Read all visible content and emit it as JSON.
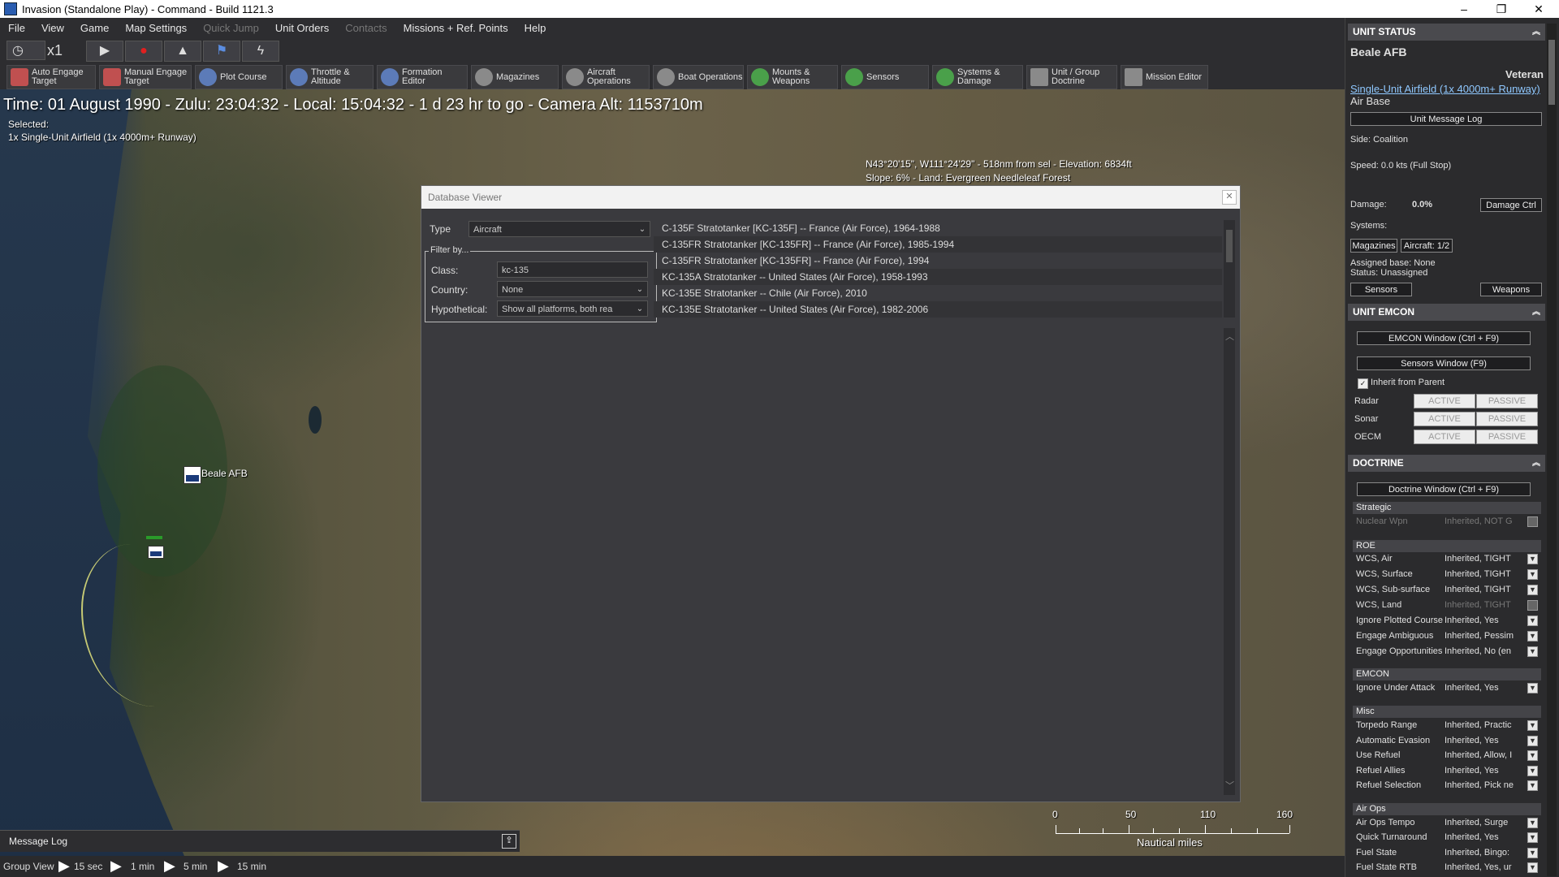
{
  "window": {
    "title": "Invasion (Standalone Play) - Command - Build 1121.3",
    "minimize": "–",
    "restore": "❐",
    "close": "✕"
  },
  "menu": [
    "File",
    "View",
    "Game",
    "Map Settings",
    "Quick Jump",
    "Unit Orders",
    "Contacts",
    "Missions + Ref. Points",
    "Help"
  ],
  "controls": {
    "speed": "x1"
  },
  "toolbar": [
    {
      "label": "Auto Engage Target"
    },
    {
      "label": "Manual Engage Target"
    },
    {
      "label": "Plot Course"
    },
    {
      "label": "Throttle & Altitude"
    },
    {
      "label": "Formation Editor"
    },
    {
      "label": "Magazines"
    },
    {
      "label": "Aircraft Operations"
    },
    {
      "label": "Boat Operations"
    },
    {
      "label": "Mounts & Weapons"
    },
    {
      "label": "Sensors"
    },
    {
      "label": "Systems & Damage"
    },
    {
      "label": "Unit / Group Doctrine"
    },
    {
      "label": "Mission Editor"
    }
  ],
  "map": {
    "time_line": "Time: 01 August 1990 - Zulu: 23:04:32 - Local: 15:04:32 - 1 d 23 hr to go -  Camera Alt: 1153710m",
    "selected_label": "Selected:",
    "selected_value": "1x Single-Unit Airfield (1x 4000m+ Runway)",
    "coords": "N43°20'15\", W111°24'29\" - 518nm from sel - Elevation: 6834ft",
    "terrain": "Slope: 6%  - Land: Evergreen Needleleaf Forest",
    "unit_label": "Beale AFB",
    "scale_ticks": [
      "0",
      "50",
      "110",
      "160"
    ],
    "scale_unit": "Nautical miles"
  },
  "dialog": {
    "title": "Database Viewer",
    "type_label": "Type",
    "type_value": "Aircraft",
    "filter_label": "Filter by...",
    "class_label": "Class:",
    "class_value": "kc-135",
    "country_label": "Country:",
    "country_value": "None",
    "hypo_label": "Hypothetical:",
    "hypo_value": "Show all platforms, both rea",
    "results": [
      "C-135F Stratotanker [KC-135F] -- France (Air Force), 1964-1988",
      "C-135FR Stratotanker [KC-135FR] -- France (Air Force), 1985-1994",
      "C-135FR Stratotanker [KC-135FR] -- France (Air Force), 1994",
      "KC-135A Stratotanker -- United States (Air Force), 1958-1993",
      "KC-135E Stratotanker -- Chile (Air Force), 2010",
      "KC-135E Stratotanker -- United States (Air Force), 1982-2006"
    ]
  },
  "panel": {
    "unit_status_head": "UNIT STATUS",
    "unit_name": "Beale AFB",
    "proficiency": "Veteran",
    "unit_class": "Single-Unit Airfield (1x 4000m+ Runway)",
    "unit_type": "Air Base",
    "msg_log_btn": "Unit Message Log",
    "side": "Side: Coalition",
    "speed": "Speed: 0.0 kts (Full Stop)",
    "damage_label": "Damage:",
    "damage_value": "0.0%",
    "damage_btn": "Damage Ctrl",
    "systems_label": "Systems:",
    "magazines_btn": "Magazines",
    "aircraft_btn": "Aircraft: 1/2",
    "assigned_base": "Assigned base: None",
    "status": "Status: Unassigned",
    "sensors_btn": "Sensors",
    "weapons_btn": "Weapons",
    "emcon_head": "UNIT EMCON",
    "emcon_window_btn": "EMCON Window (Ctrl + F9)",
    "sensors_window_btn": "Sensors Window (F9)",
    "inherit_label": "Inherit from Parent",
    "emcon_rows": [
      {
        "name": "Radar",
        "active": "ACTIVE",
        "passive": "PASSIVE"
      },
      {
        "name": "Sonar",
        "active": "ACTIVE",
        "passive": "PASSIVE"
      },
      {
        "name": "OECM",
        "active": "ACTIVE",
        "passive": "PASSIVE"
      }
    ],
    "doctrine_head": "DOCTRINE",
    "doctrine_window_btn": "Doctrine Window (Ctrl + F9)",
    "strategic_head": "Strategic",
    "nuclear": {
      "name": "Nuclear Wpn",
      "value": "Inherited, NOT G"
    },
    "roe_head": "ROE",
    "roe": [
      {
        "name": "WCS, Air",
        "value": "Inherited, TIGHT"
      },
      {
        "name": "WCS, Surface",
        "value": "Inherited, TIGHT"
      },
      {
        "name": "WCS, Sub-surface",
        "value": "Inherited, TIGHT"
      },
      {
        "name": "WCS, Land",
        "value": "Inherited, TIGHT"
      },
      {
        "name": "Ignore Plotted Course",
        "value": "Inherited, Yes"
      },
      {
        "name": "Engage Ambiguous",
        "value": "Inherited, Pessim"
      },
      {
        "name": "Engage Opportunities",
        "value": "Inherited, No (en"
      }
    ],
    "emcon2_head": "EMCON",
    "ignore_attack": {
      "name": "Ignore Under Attack",
      "value": "Inherited, Yes"
    },
    "misc_head": "Misc",
    "misc": [
      {
        "name": "Torpedo Range",
        "value": "Inherited, Practic"
      },
      {
        "name": "Automatic Evasion",
        "value": "Inherited, Yes"
      },
      {
        "name": "Use Refuel",
        "value": "Inherited, Allow, I"
      },
      {
        "name": "Refuel Allies",
        "value": "Inherited, Yes"
      },
      {
        "name": "Refuel Selection",
        "value": "Inherited, Pick ne"
      }
    ],
    "airops_head": "Air Ops",
    "airops": [
      {
        "name": "Air Ops Tempo",
        "value": "Inherited, Surge"
      },
      {
        "name": "Quick Turnaround",
        "value": "Inherited, Yes"
      },
      {
        "name": "Fuel State",
        "value": "Inherited, Bingo:"
      },
      {
        "name": "Fuel State RTB",
        "value": "Inherited, Yes, ur"
      }
    ]
  },
  "bottom": {
    "message_log": "Message Log",
    "group_view": "Group View",
    "times": [
      "15 sec",
      "1 min",
      "5 min",
      "15 min"
    ]
  }
}
